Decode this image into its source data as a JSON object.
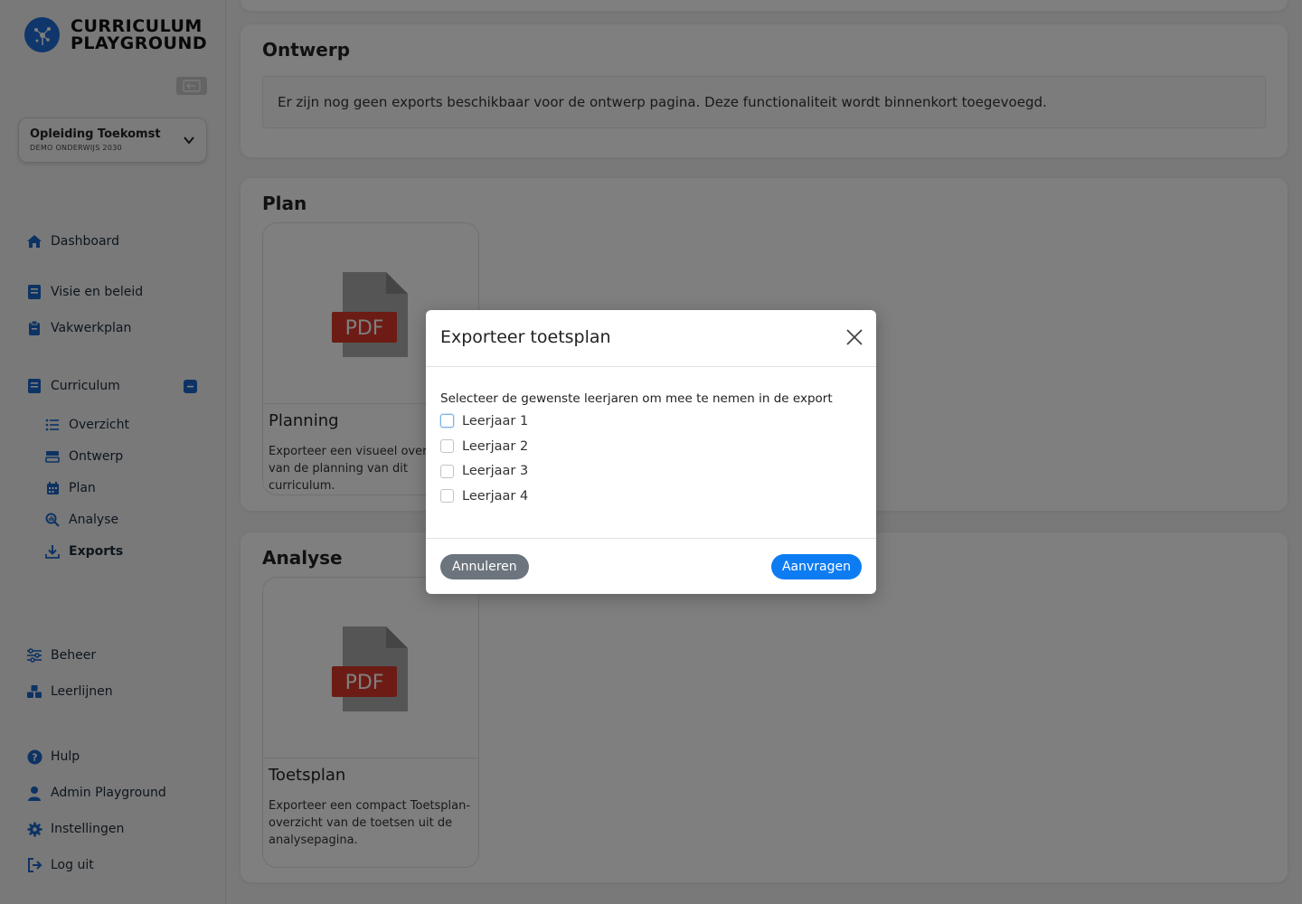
{
  "brand": {
    "line1": "CURRICULUM",
    "line2": "PLAYGROUND"
  },
  "org": {
    "name": "Opleiding Toekomst",
    "sub": "DEMO ONDERWIJS 2030"
  },
  "nav": {
    "dashboard": "Dashboard",
    "visie": "Visie en beleid",
    "vakwerkplan": "Vakwerkplan",
    "curriculum": "Curriculum",
    "overzicht": "Overzicht",
    "ontwerp": "Ontwerp",
    "plan": "Plan",
    "analyse": "Analyse",
    "exports": "Exports",
    "beheer": "Beheer",
    "leerlijnen": "Leerlijnen",
    "hulp": "Hulp",
    "admin": "Admin Playground",
    "instellingen": "Instellingen",
    "logout": "Log uit"
  },
  "main": {
    "ontwerp": {
      "title": "Ontwerp",
      "info": "Er zijn nog geen exports beschikbaar voor de ontwerp pagina. Deze functionaliteit wordt binnenkort toegevoegd."
    },
    "plan": {
      "title": "Plan",
      "card": {
        "badge": "PDF",
        "title": "Planning",
        "desc": "Exporteer een visueel overzicht van de planning van dit curriculum."
      }
    },
    "analyse": {
      "title": "Analyse",
      "card": {
        "badge": "PDF",
        "title": "Toetsplan",
        "desc": "Exporteer een compact Toetsplan-overzicht van de toetsen uit de analysepagina."
      }
    }
  },
  "modal": {
    "title": "Exporteer toetsplan",
    "label": "Selecteer de gewenste leerjaren om mee te nemen in de export",
    "options": [
      "Leerjaar 1",
      "Leerjaar 2",
      "Leerjaar 3",
      "Leerjaar 4"
    ],
    "cancel": "Annuleren",
    "submit": "Aanvragen"
  },
  "colors": {
    "primary": "#0d7cf2",
    "secondary": "#6c757d",
    "pdf": "#d8392b"
  }
}
